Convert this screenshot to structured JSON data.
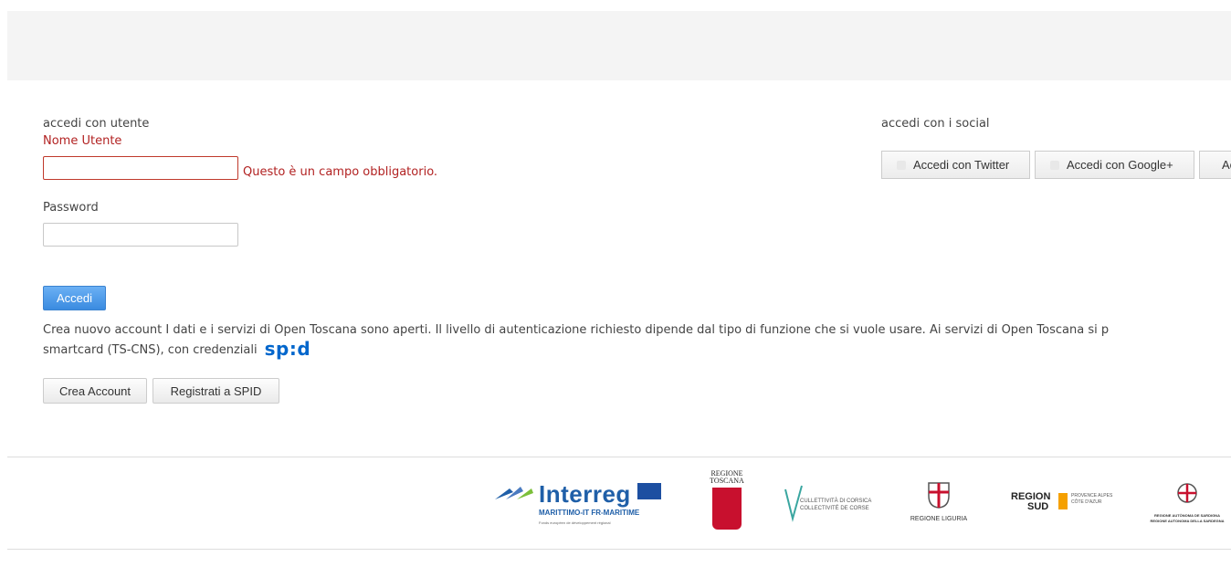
{
  "login": {
    "section_title": "accedi con utente",
    "username_label": "Nome Utente",
    "username_error": "Questo è un campo obbligatorio.",
    "username_value": "",
    "password_label": "Password",
    "password_value": "",
    "submit_label": "Accedi"
  },
  "social": {
    "section_title": "accedi con i social",
    "twitter_label": "Accedi con Twitter",
    "google_label": "Accedi con Google+",
    "third_label": "Ac"
  },
  "info": {
    "line1": "Crea nuovo account I dati e i servizi di Open Toscana sono aperti. Il livello di autenticazione richiesto dipende dal tipo di funzione che si vuole usare. Ai servizi di Open Toscana si p",
    "line2": "smartcard (TS-CNS), con credenziali",
    "spid_logo": "sp:d"
  },
  "buttons": {
    "create_account": "Crea Account",
    "register_spid": "Registrati a SPID"
  },
  "footer": {
    "interreg_title": "Interreg",
    "interreg_sub": "MARITTIMO-IT FR-MARITIME",
    "interreg_fine": "Fonds européen de développement régional",
    "toscana": "REGIONE TOSCANA",
    "corsica_1": "CULLETTIVITÀ DI CORSICA",
    "corsica_2": "COLLECTIVITÉ DE CORSE",
    "liguria": "REGIONE LIGURIA",
    "sud_title_1": "REGION",
    "sud_title_2": "SUD",
    "sud_sub": "PROVENCE ALPES CÔTE D'AZUR",
    "sardegna_1": "REGIONE AUTÒNOMA DE SARDIGNA",
    "sardegna_2": "REGIONE AUTONOMA DELLA SARDEGNA"
  },
  "colors": {
    "error": "#b22222",
    "primary": "#3a8be0",
    "spid": "#0066cc",
    "interreg": "#1f5fa8"
  }
}
